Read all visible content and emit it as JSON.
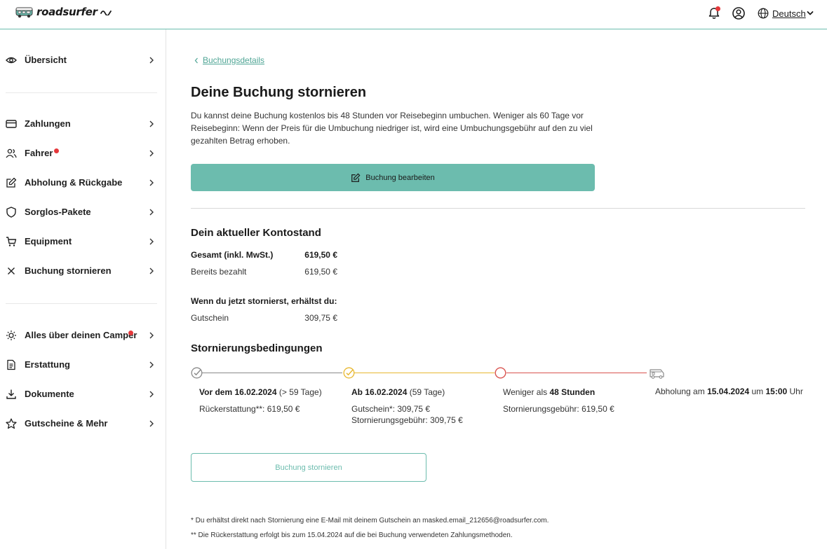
{
  "header": {
    "logo_text": "roadsurfer",
    "language": "Deutsch",
    "icons": [
      "bell-icon",
      "user-icon",
      "globe-icon",
      "chevron-down-icon"
    ],
    "colors": {
      "accent": "#6cbcae",
      "notification": "#e5383b"
    }
  },
  "sidebar": {
    "items": [
      {
        "label": "Übersicht",
        "icon": "eye-icon"
      },
      {
        "label": "Zahlungen",
        "icon": "credit-card-icon"
      },
      {
        "label": "Fahrer",
        "icon": "users-icon",
        "badge": true
      },
      {
        "label": "Abholung & Rückgabe",
        "icon": "edit-icon"
      },
      {
        "label": "Sorglos-Pakete",
        "icon": "shield-icon"
      },
      {
        "label": "Equipment",
        "icon": "cart-icon"
      },
      {
        "label": "Buchung stornieren",
        "icon": "x-icon"
      },
      {
        "label": "Alles über deinen Camper",
        "icon": "lightbulb-icon",
        "badge": true
      },
      {
        "label": "Erstattung",
        "icon": "document-icon"
      },
      {
        "label": "Dokumente",
        "icon": "download-icon"
      },
      {
        "label": "Gutscheine & Mehr",
        "icon": "star-icon"
      }
    ]
  },
  "main": {
    "back_link": "Buchungsdetails",
    "title": "Deine Buchung stornieren",
    "intro": "Du kannst deine Buchung kostenlos bis 48 Stunden vor Reisebeginn umbuchen. Weniger als 60 Tage vor Reisebeginn: Wenn der Preis für die Umbuchung niedriger ist, wird eine Umbuchungsgebühr auf den zu viel gezahlten Betrag erhoben.",
    "edit_button": "Buchung bearbeiten",
    "balance": {
      "heading": "Dein aktueller Kontostand",
      "total_label": "Gesamt (inkl. MwSt.)",
      "total_value": "619,50 €",
      "paid_label": "Bereits bezahlt",
      "paid_value": "619,50 €",
      "cancel_heading": "Wenn du jetzt stornierst, erhältst du:",
      "voucher_label": "Gutschein",
      "voucher_value": "309,75 €"
    },
    "conditions": {
      "heading": "Stornierungsbedingungen",
      "col1": {
        "date_prefix": "Vor dem ",
        "date": "16.02.2024",
        "days": " (> 59 Tage)",
        "line1": "Rückerstattung**: 619,50 €"
      },
      "col2": {
        "date_prefix": "Ab ",
        "date": "16.02.2024",
        "days": " (59 Tage)",
        "line1": "Gutschein*: 309,75 €",
        "line2": "Stornierungsgebühr: 309,75 €"
      },
      "col3": {
        "prefix": "Weniger als ",
        "bold": "48 Stunden",
        "line1": "Stornierungsgebühr: 619,50 €"
      },
      "col4": {
        "prefix": "Abholung am ",
        "date": "15.04.2024",
        "mid": " um ",
        "time": "15:00",
        "suffix": " Uhr"
      },
      "colors": {
        "gray": "#8a8a8a",
        "yellow": "#e8b830",
        "red": "#d9534f"
      }
    },
    "cancel_button": "Buchung stornieren",
    "footnote1": "* Du erhältst direkt nach Stornierung eine E-Mail mit deinem Gutschein an masked.email_212656@roadsurfer.com.",
    "footnote2": "** Die Rückerstattung erfolgt bis zum 15.04.2024 auf die bei Buchung verwendeten Zahlungsmethoden."
  }
}
